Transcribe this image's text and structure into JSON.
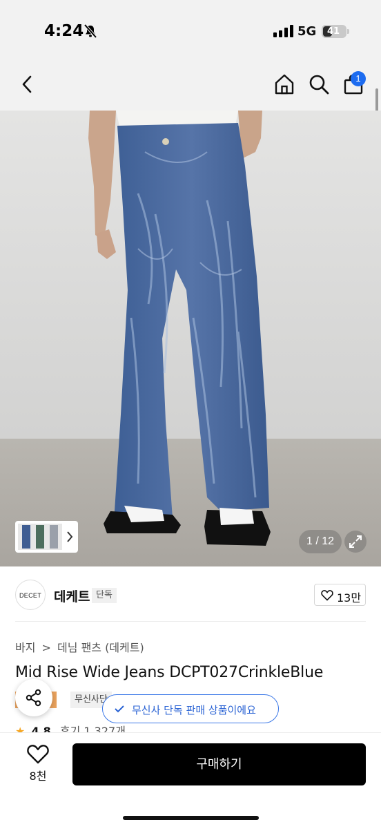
{
  "status_bar": {
    "time": "4:24",
    "network": "5G",
    "battery": "41",
    "battery_level": 0.41
  },
  "nav": {
    "cart_badge": "1"
  },
  "gallery": {
    "counter": "1 / 12"
  },
  "brand": {
    "logo_text": "DECET",
    "name": "데케트",
    "tag": "단독",
    "like_count": "13만"
  },
  "breadcrumb": {
    "category": "바지",
    "separator": ">",
    "subcategory": "데님 팬츠 (데케트)"
  },
  "product": {
    "title": "Mid Rise Wide Jeans DCPT027CrinkleBlue",
    "badge_orange": "일",
    "badge_gray": "무신사단"
  },
  "toast": {
    "text": "무신사 단독 판매 상품이에요"
  },
  "rating": {
    "star": "★",
    "value": "4.8",
    "reviews": "후기 1,327개"
  },
  "bottom": {
    "wish_count": "8천",
    "buy_label": "구매하기"
  },
  "colors": {
    "accent_blue": "#1d6cf0",
    "toast_blue": "#3b78e7",
    "badge_orange": "#e9a25d",
    "buy_black": "#000000"
  }
}
